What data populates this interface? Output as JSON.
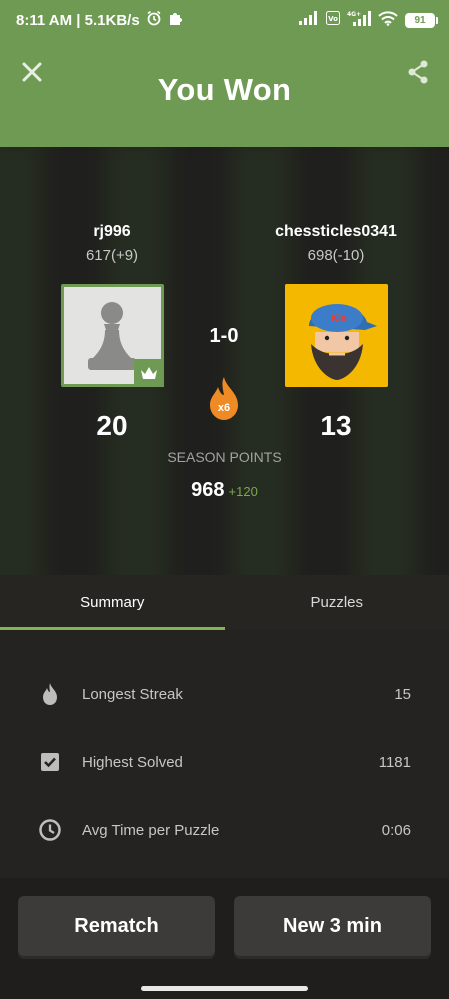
{
  "status_bar": {
    "time_speed": "8:11 AM | 5.1KB/s",
    "battery": "91",
    "network": "4G+"
  },
  "header": {
    "title": "You Won",
    "close_icon": "close-icon",
    "share_icon": "share-icon",
    "background_color": "#6f9a54"
  },
  "players": {
    "left": {
      "name": "rj996",
      "rating": "617(+9)",
      "points": "20"
    },
    "right": {
      "name": "chessticles0341",
      "rating": "698(-10)",
      "points": "13"
    }
  },
  "match": {
    "score": "1-0",
    "streak_multiplier": "x6",
    "season_label": "SEASON POINTS",
    "season_total": "968",
    "season_delta": "+120"
  },
  "tabs": [
    {
      "label": "Summary",
      "active": true
    },
    {
      "label": "Puzzles",
      "active": false
    }
  ],
  "summary": {
    "rows": [
      {
        "icon": "flame-icon",
        "label": "Longest Streak",
        "value": "15"
      },
      {
        "icon": "checkbox-icon",
        "label": "Highest Solved",
        "value": "1181"
      },
      {
        "icon": "clock-icon",
        "label": "Avg Time per Puzzle",
        "value": "0:06"
      }
    ]
  },
  "buttons": {
    "rematch": "Rematch",
    "new_game": "New 3 min"
  },
  "colors": {
    "accent_green": "#81b64c",
    "header_green": "#6f9a54",
    "flame_orange": "#f08a24",
    "avatar_yellow": "#f5b800"
  }
}
